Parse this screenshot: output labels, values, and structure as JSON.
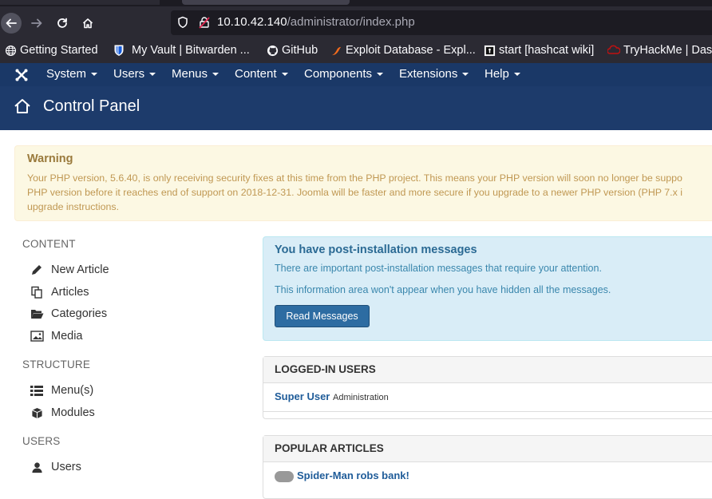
{
  "browser": {
    "url_host": "10.10.42.140",
    "url_path": "/administrator/index.php",
    "bookmarks": [
      {
        "label": "Getting Started",
        "icon": "globe-icon"
      },
      {
        "label": "My Vault | Bitwarden ...",
        "icon": "bitwarden-shield-icon"
      },
      {
        "label": "GitHub",
        "icon": "github-icon"
      },
      {
        "label": "Exploit Database - Expl...",
        "icon": "exploit-db-icon"
      },
      {
        "label": "start [hashcat wiki]",
        "icon": "hashcat-icon"
      },
      {
        "label": "TryHackMe | Das",
        "icon": "tryhackme-icon"
      }
    ]
  },
  "nav": {
    "menus": [
      "System",
      "Users",
      "Menus",
      "Content",
      "Components",
      "Extensions",
      "Help"
    ]
  },
  "header": {
    "title": "Control Panel"
  },
  "warning": {
    "title": "Warning",
    "lines": [
      "Your PHP version, 5.6.40, is only receiving security fixes at this time from the PHP project. This means your PHP version will soon no longer be suppo",
      "PHP version before it reaches end of support on 2018-12-31. Joomla will be faster and more secure if you upgrade to a newer PHP version (PHP 7.x i",
      "upgrade instructions."
    ]
  },
  "sidebar": {
    "content_heading": "CONTENT",
    "content_items": [
      "New Article",
      "Articles",
      "Categories",
      "Media"
    ],
    "structure_heading": "STRUCTURE",
    "structure_items": [
      "Menu(s)",
      "Modules"
    ],
    "users_heading": "USERS",
    "users_items": [
      "Users"
    ]
  },
  "postinstall": {
    "title": "You have post-installation messages",
    "line1": "There are important post-installation messages that require your attention.",
    "line2": "This information area won't appear when you have hidden all the messages.",
    "button": "Read Messages"
  },
  "logged_in": {
    "heading": "LOGGED-IN USERS",
    "user": "Super User",
    "area": "Administration"
  },
  "popular": {
    "heading": "POPULAR ARTICLES",
    "first_article": "Spider-Man robs bank!"
  },
  "colors": {
    "joomla_nav": "#1a3867",
    "joomla_header": "#1d3b6b",
    "warning_bg": "#fcf8e3",
    "info_bg": "#d9edf7",
    "button_primary": "#2d6ca2"
  }
}
